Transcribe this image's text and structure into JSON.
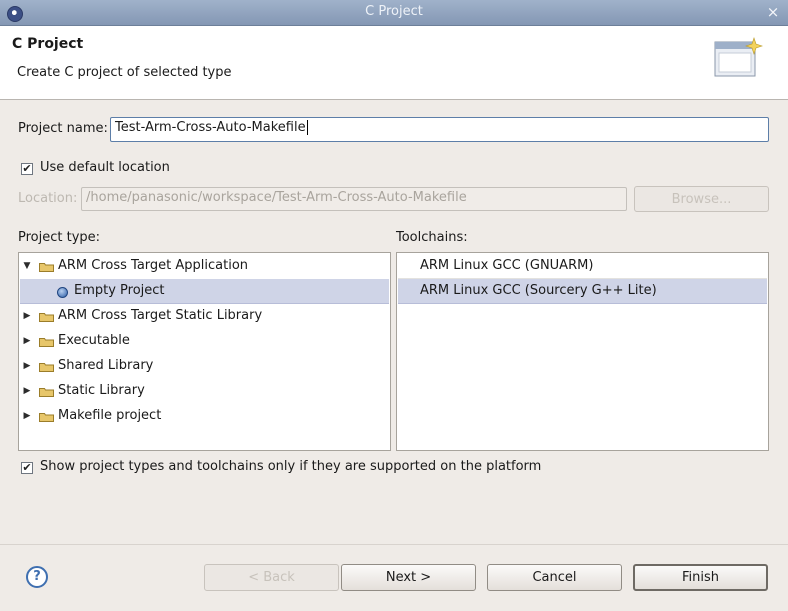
{
  "window": {
    "title": "C Project",
    "close_glyph": "×"
  },
  "header": {
    "title": "C Project",
    "subtitle": "Create C project of selected type"
  },
  "form": {
    "project_name_label": "Project name:",
    "project_name_value": "Test-Arm-Cross-Auto-Makefile",
    "use_default_location_label": "Use default location",
    "use_default_location_checked": true,
    "location_label": "Location:",
    "location_value": "/home/panasonic/workspace/Test-Arm-Cross-Auto-Makefile",
    "browse_label": "Browse..."
  },
  "project_type": {
    "label": "Project type:",
    "items": [
      {
        "label": "ARM Cross Target Application",
        "expanded": true,
        "icon": "folder-icon"
      },
      {
        "label": "Empty Project",
        "selected": true,
        "icon": "bullet-icon"
      },
      {
        "label": "ARM Cross Target Static Library",
        "icon": "folder-icon"
      },
      {
        "label": "Executable",
        "icon": "folder-icon"
      },
      {
        "label": "Shared Library",
        "icon": "folder-icon"
      },
      {
        "label": "Static Library",
        "icon": "folder-icon"
      },
      {
        "label": "Makefile project",
        "icon": "folder-icon"
      }
    ]
  },
  "toolchains": {
    "label": "Toolchains:",
    "items": [
      {
        "label": "ARM Linux GCC (GNUARM)"
      },
      {
        "label": "ARM Linux GCC (Sourcery G++ Lite)",
        "selected": true
      }
    ]
  },
  "show_supported": {
    "label": "Show project types and toolchains only if they are supported on the platform",
    "checked": true
  },
  "buttons": {
    "back": "< Back",
    "next": "Next >",
    "cancel": "Cancel",
    "finish": "Finish"
  },
  "icons": {
    "help": "?",
    "check": "✔"
  },
  "colors": {
    "selection": "#cfd4e7",
    "titlebar": "#8fa2be",
    "folder": "#e7c66a"
  }
}
